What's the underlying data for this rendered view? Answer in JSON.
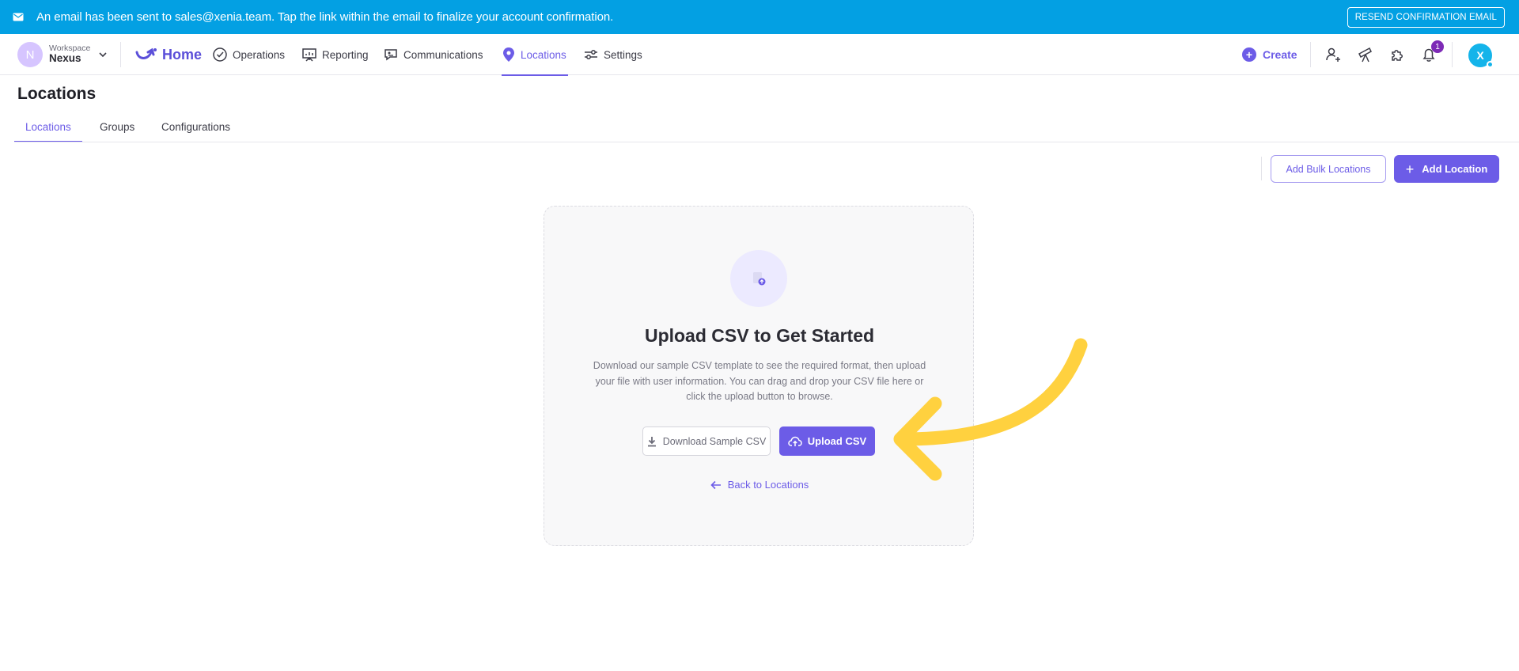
{
  "banner": {
    "message": "An email has been sent to sales@xenia.team. Tap the link within the email to finalize your account confirmation.",
    "resend_label": "RESEND CONFIRMATION EMAIL"
  },
  "workspace": {
    "label": "Workspace",
    "name": "Nexus",
    "avatar_letter": "N"
  },
  "nav": {
    "home": "Home",
    "items": [
      "Operations",
      "Reporting",
      "Communications",
      "Locations",
      "Settings"
    ],
    "active": "Locations",
    "create_label": "Create",
    "notification_count": "1",
    "user_initial": "X"
  },
  "page": {
    "title": "Locations",
    "tabs": [
      "Locations",
      "Groups",
      "Configurations"
    ],
    "active_tab": "Locations",
    "add_bulk_label": "Add Bulk Locations",
    "add_location_label": "Add Location"
  },
  "upload": {
    "title": "Upload CSV to Get Started",
    "description": "Download our sample CSV template to see the required format, then upload your file with user information. You can drag and drop your CSV file here or click the upload button to browse.",
    "download_label": "Download Sample CSV",
    "upload_label": "Upload CSV",
    "back_label": "Back to Locations"
  },
  "colors": {
    "banner": "#03A0E3",
    "accent": "#6C5CE7",
    "annotation_arrow": "#FFD13F"
  }
}
